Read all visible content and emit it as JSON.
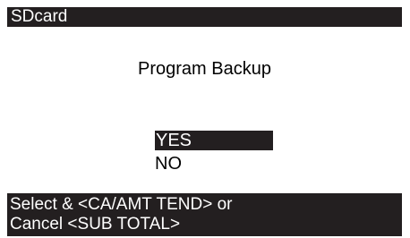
{
  "title_bar": {
    "title": "SDcard"
  },
  "dialog": {
    "title": "Program Backup",
    "options": [
      {
        "label": "YES",
        "selected": true
      },
      {
        "label": "NO",
        "selected": false
      }
    ]
  },
  "status_bar": {
    "line1": "Select & <CA/AMT TEND> or",
    "line2": "Cancel <SUB TOTAL>"
  },
  "colors": {
    "bar_background": "#231f20",
    "screen_background": "#ffffff",
    "highlight_text": "#ffffff"
  }
}
